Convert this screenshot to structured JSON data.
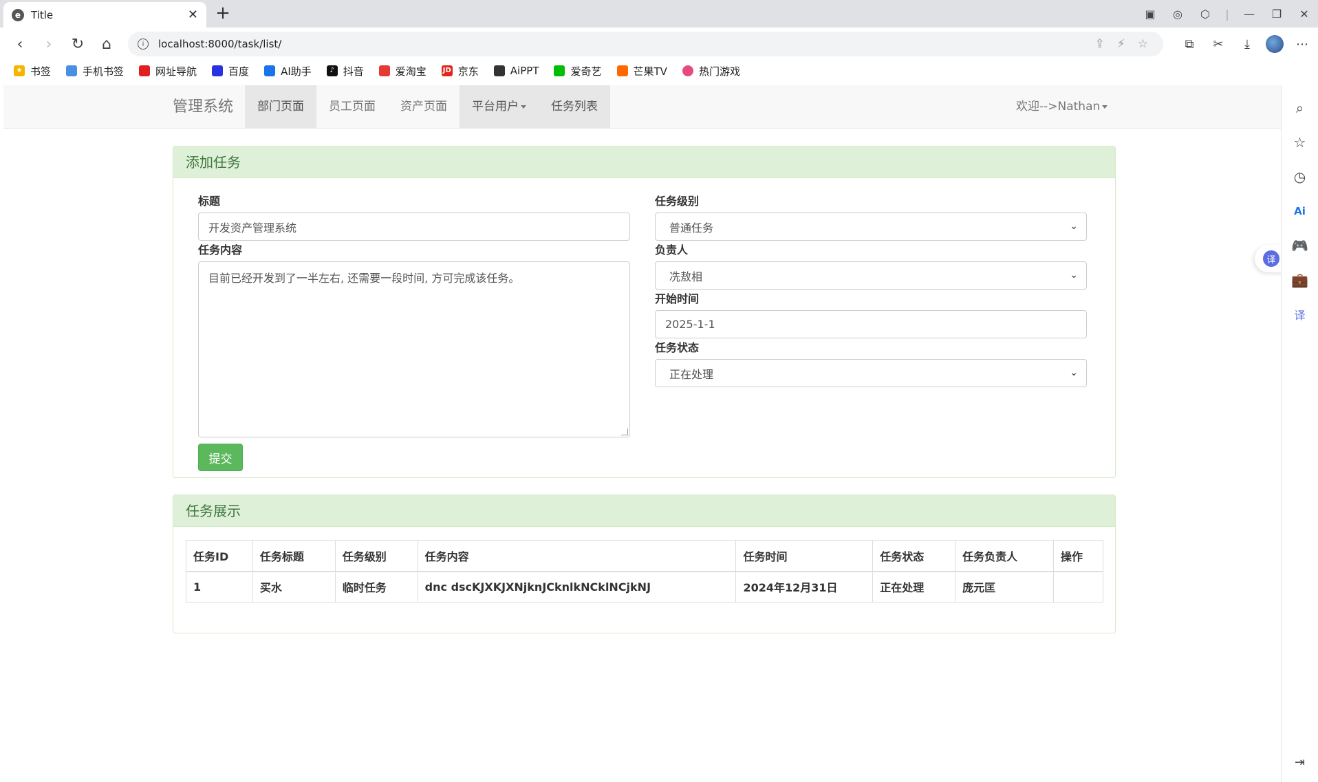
{
  "browser": {
    "tab_title": "Title",
    "url": "localhost:8000/task/list/",
    "bookmarks": [
      "书签",
      "手机书签",
      "网址导航",
      "百度",
      "AI助手",
      "抖音",
      "爱淘宝",
      "京东",
      "AiPPT",
      "爱奇艺",
      "芒果TV",
      "热门游戏"
    ]
  },
  "navbar": {
    "brand": "管理系统",
    "items": [
      "部门页面",
      "员工页面",
      "资产页面",
      "平台用户",
      "任务列表"
    ],
    "user_menu": "欢迎-->Nathan"
  },
  "add_panel": {
    "heading": "添加任务",
    "title_label": "标题",
    "title_value": "开发资产管理系统",
    "content_label": "任务内容",
    "content_value": "目前已经开发到了一半左右, 还需要一段时间, 方可完成该任务。",
    "level_label": "任务级别",
    "level_value": "普通任务",
    "owner_label": "负责人",
    "owner_value": "冼敖相",
    "start_label": "开始时间",
    "start_value": "2025-1-1",
    "status_label": "任务状态",
    "status_value": "正在处理",
    "submit_label": "提交"
  },
  "list_panel": {
    "heading": "任务展示",
    "columns": [
      "任务ID",
      "任务标题",
      "任务级别",
      "任务内容",
      "任务时间",
      "任务状态",
      "任务负责人",
      "操作"
    ],
    "rows": [
      [
        "1",
        "买水",
        "临时任务",
        "dnc dscKJXKJXNjknJCknlkNCklNCjkNJ",
        "2024年12月31日",
        "正在处理",
        "庞元匡",
        ""
      ]
    ]
  }
}
